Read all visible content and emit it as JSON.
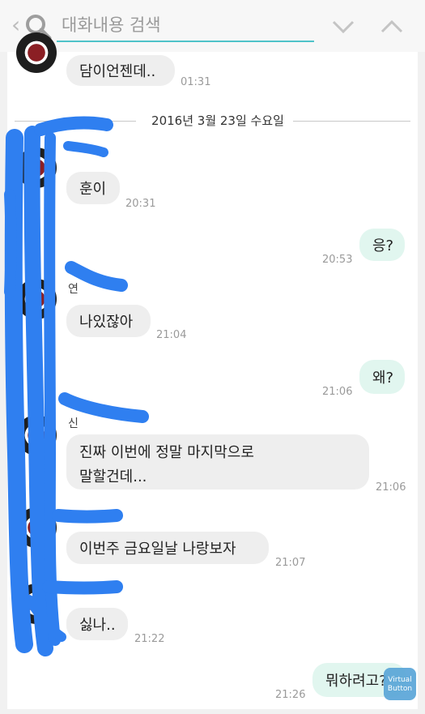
{
  "search": {
    "placeholder": "대화내용 검색",
    "value": ""
  },
  "date_divider": "2016년 3월 23일 수요일",
  "messages": [
    {
      "text": "담이언젠데..",
      "time": "01:31"
    },
    {
      "text": "훈이",
      "time": "20:31"
    },
    {
      "text": "응?",
      "time": "20:53"
    },
    {
      "sender_fragment": "연",
      "text": "나있잖아",
      "time": "21:04"
    },
    {
      "text": "왜?",
      "time": "21:06"
    },
    {
      "sender_fragment": "신",
      "text": "진짜 이번에 정말 마지막으로\n말할건데...",
      "line1": "진짜 이번에 정말 마지막으로",
      "line2": "말할건데...",
      "time": "21:06"
    },
    {
      "text": "이번주 금요일날 나랑보자",
      "time": "21:07"
    },
    {
      "text": "싫나..",
      "time": "21:22"
    },
    {
      "text": "뭐하려고?",
      "time": "21:26"
    }
  ],
  "overlay": {
    "virtual_button_line1": "Virtual",
    "virtual_button_line2": "Button"
  },
  "colors": {
    "accent": "#4fc3c9",
    "outgoing_bubble": "#e1f6ef",
    "incoming_bubble": "#eeeeee",
    "scribble": "#2f7ff0"
  }
}
